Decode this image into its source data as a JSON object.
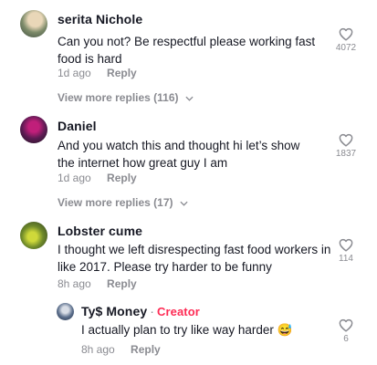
{
  "comments": [
    {
      "username": "serita Nichole",
      "text": "Can you not? Be respectful please working fast food is hard",
      "time": "1d ago",
      "reply_label": "Reply",
      "likes": "4072",
      "view_more": "View more replies (116)"
    },
    {
      "username": "Daniel",
      "text": "And you watch this and thought hi let’s show the internet how great guy I am",
      "time": "1d ago",
      "reply_label": "Reply",
      "likes": "1837",
      "view_more": "View more replies (17)"
    },
    {
      "username": "Lobster cume",
      "text": "I thought we left disrespecting fast food workers in like 2017. Please try harder to be funny",
      "time": "8h ago",
      "reply_label": "Reply",
      "likes": "114"
    }
  ],
  "reply": {
    "username": "Ty$ Money",
    "separator": "·",
    "badge": "Creator",
    "text": "I actually plan to try like way harder 😅",
    "time": "8h ago",
    "reply_label": "Reply",
    "likes": "6"
  },
  "icons": {
    "like": "heart-outline-icon",
    "expand": "chevron-down-icon"
  },
  "colors": {
    "primary_text": "#161823",
    "secondary_text": "#8a8b91",
    "creator_badge": "#fe2c55"
  }
}
